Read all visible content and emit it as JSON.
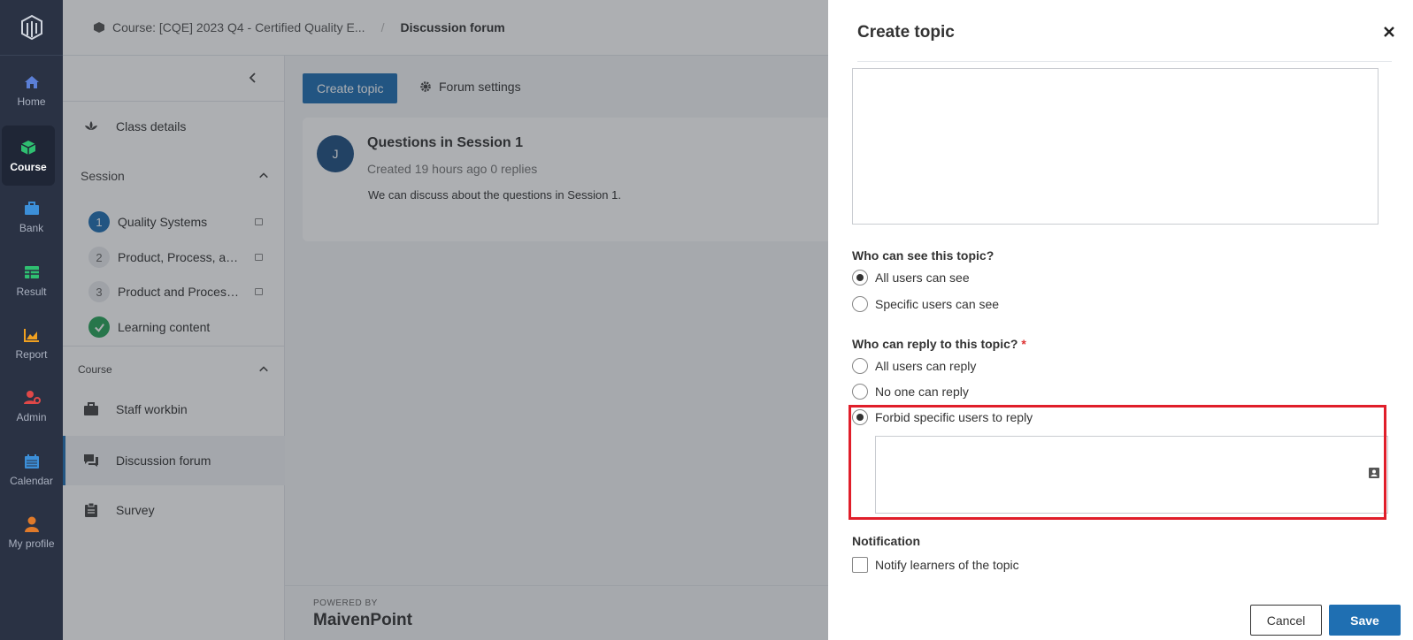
{
  "rail": {
    "items": [
      {
        "label": "Home",
        "icon": "home-icon",
        "color": "#5b7fd6"
      },
      {
        "label": "Course",
        "icon": "cube-icon",
        "color": "#2fbf71"
      },
      {
        "label": "Bank",
        "icon": "briefcase-icon",
        "color": "#3c8fd8"
      },
      {
        "label": "Result",
        "icon": "table-icon",
        "color": "#2fbf71"
      },
      {
        "label": "Report",
        "icon": "chart-icon",
        "color": "#f0a020"
      },
      {
        "label": "Admin",
        "icon": "user-gear-icon",
        "color": "#e04848"
      },
      {
        "label": "Calendar",
        "icon": "calendar-icon",
        "color": "#3c8fd8"
      },
      {
        "label": "My profile",
        "icon": "person-icon",
        "color": "#e07a2a"
      }
    ]
  },
  "breadcrumb": {
    "course": "Course: [CQE] 2023 Q4 - Certified Quality E...",
    "separator": "/",
    "current": "Discussion forum"
  },
  "sidebar": {
    "class_details": "Class details",
    "session_header": "Session",
    "sessions": [
      {
        "num": "1",
        "label": "Quality Systems"
      },
      {
        "num": "2",
        "label": "Product, Process, and ..."
      },
      {
        "num": "3",
        "label": "Product and Process ..."
      }
    ],
    "learning_content": "Learning content",
    "course_header": "Course",
    "staff_workbin": "Staff workbin",
    "discussion_forum": "Discussion forum",
    "survey": "Survey"
  },
  "main": {
    "create_topic": "Create topic",
    "forum_settings": "Forum settings",
    "topic": {
      "avatar": "J",
      "title": "Questions in Session 1",
      "meta": "Created 19 hours ago  0 replies",
      "body": "We can discuss about the questions in Session 1."
    },
    "footer": {
      "powered_by": "POWERED BY",
      "brand": "MaivenPoint"
    }
  },
  "panel": {
    "title": "Create topic",
    "visibility": {
      "question": "Who can see this topic?",
      "options": [
        "All users can see",
        "Specific users can see"
      ]
    },
    "reply": {
      "question": "Who can reply to this topic?",
      "required": "*",
      "options": [
        "All users can reply",
        "No one can reply",
        "Forbid specific users to reply"
      ]
    },
    "notification": {
      "label": "Notification",
      "checkbox": "Notify learners of the topic"
    },
    "cancel": "Cancel",
    "save": "Save"
  }
}
